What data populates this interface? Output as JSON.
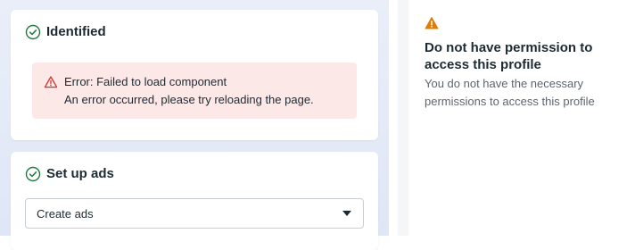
{
  "cards": {
    "identified": {
      "title": "Identified",
      "status_icon": "check-circle-icon",
      "error": {
        "icon": "warning-triangle-icon",
        "title": "Error: Failed to load component",
        "message": "An error occurred, please try reloading the page."
      }
    },
    "setup_ads": {
      "title": "Set up ads",
      "status_icon": "check-circle-icon",
      "select": {
        "value": "Create ads",
        "icon": "caret-down-icon"
      }
    }
  },
  "permission_panel": {
    "icon": "warning-filled-icon",
    "title": "Do not have permission to access this profile",
    "message": "You do not have the necessary permissions to access this profile"
  },
  "colors": {
    "success": "#1f7a3a",
    "error_bg": "#fde8e8",
    "error_icon": "#c8382c",
    "warning": "#e07c00"
  }
}
